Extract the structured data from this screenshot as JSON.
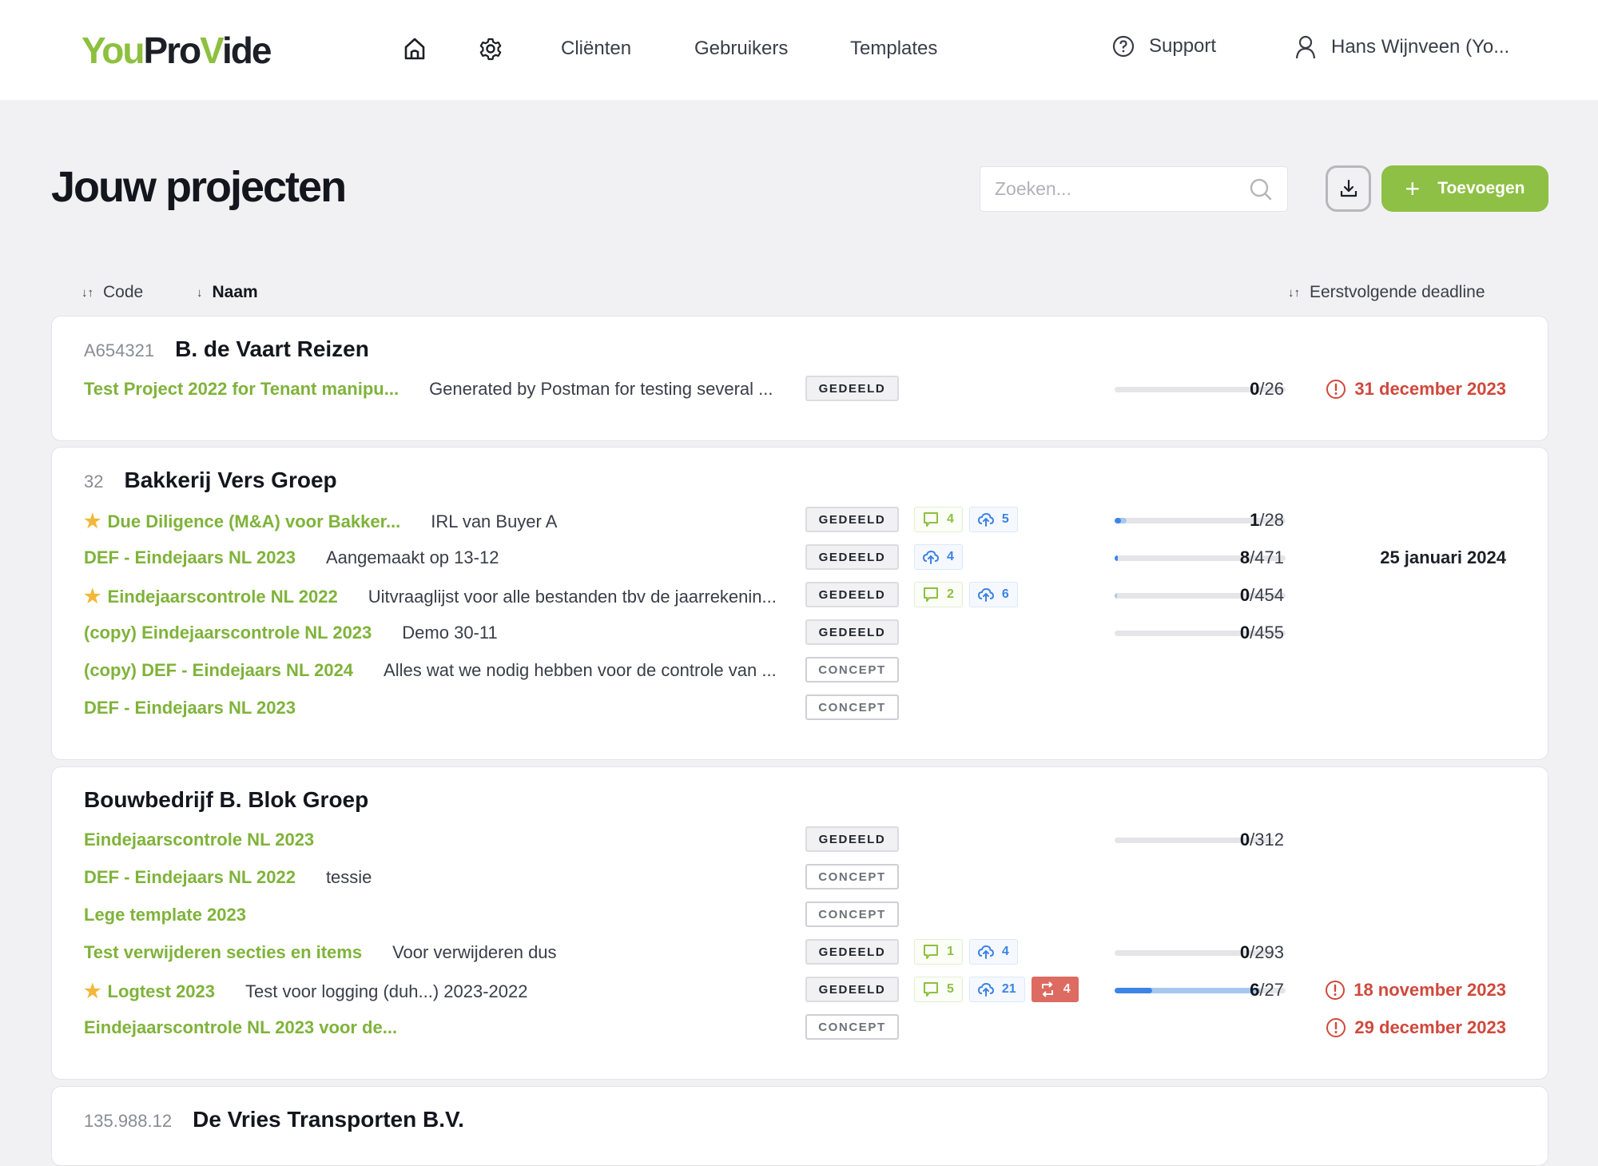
{
  "app": {
    "logo_part1": "You",
    "logo_part2": "Pro",
    "logo_part3": "V",
    "logo_part4": "ide"
  },
  "nav": {
    "home_icon": "home-icon",
    "settings_icon": "gear-icon",
    "links": [
      "Cliënten",
      "Gebruikers",
      "Templates"
    ],
    "support": "Support",
    "user": "Hans Wijnveen (Yo..."
  },
  "header": {
    "title": "Jouw projecten",
    "search_placeholder": "Zoeken...",
    "add_label": "Toevoegen",
    "add_icon": "+"
  },
  "sort": {
    "code": "Code",
    "name": "Naam",
    "deadline": "Eerstvolgende deadline"
  },
  "colors": {
    "brand_green": "#8dc044",
    "overdue_red": "#d0483c",
    "upload_blue": "#3b82e6"
  },
  "clients": [
    {
      "code": "A654321",
      "name": "B. de Vaart Reizen",
      "projects": [
        {
          "title": "Test Project 2022 for Tenant manipu...",
          "starred": false,
          "desc": "Generated by Postman for testing several ...",
          "status": "GEDEELD",
          "comments": null,
          "uploads": null,
          "issues": null,
          "done": "0",
          "total": "/26",
          "progress": 0,
          "progress_secondary": 0,
          "deadline": "31 december 2023",
          "overdue": true
        }
      ]
    },
    {
      "code": "32",
      "name": "Bakkerij Vers Groep",
      "projects": [
        {
          "title": "Due Diligence (M&A) voor Bakker...",
          "starred": true,
          "desc": "IRL van Buyer A",
          "status": "GEDEELD",
          "comments": "4",
          "uploads": "5",
          "issues": null,
          "done": "1",
          "total": "/28",
          "progress": 0.036,
          "progress_secondary": 0.07,
          "deadline": "",
          "overdue": false
        },
        {
          "title": "DEF - Eindejaars NL 2023",
          "starred": false,
          "desc": "Aangemaakt op 13-12",
          "status": "GEDEELD",
          "comments": null,
          "uploads": "4",
          "issues": null,
          "done": "8",
          "total": "/471",
          "progress": 0.017,
          "progress_secondary": 0.017,
          "deadline": "25 januari 2024",
          "overdue": false
        },
        {
          "title": "Eindejaarscontrole NL 2022",
          "starred": true,
          "desc": "Uitvraaglijst voor alle bestanden tbv de jaarrekenin...",
          "status": "GEDEELD",
          "comments": "2",
          "uploads": "6",
          "issues": null,
          "done": "0",
          "total": "/454",
          "progress": 0,
          "progress_secondary": 0.013,
          "deadline": "",
          "overdue": false
        },
        {
          "title": "(copy) Eindejaarscontrole NL 2023",
          "starred": false,
          "desc": "Demo 30-11",
          "status": "GEDEELD",
          "comments": null,
          "uploads": null,
          "issues": null,
          "done": "0",
          "total": "/455",
          "progress": 0,
          "progress_secondary": 0,
          "deadline": "",
          "overdue": false
        },
        {
          "title": "(copy) DEF - Eindejaars NL 2024",
          "starred": false,
          "desc": "Alles wat we nodig hebben voor de controle van ...",
          "status": "CONCEPT",
          "comments": null,
          "uploads": null,
          "issues": null,
          "done": null,
          "total": null,
          "progress": null,
          "progress_secondary": null,
          "deadline": "",
          "overdue": false
        },
        {
          "title": "DEF - Eindejaars NL 2023",
          "starred": false,
          "desc": "",
          "status": "CONCEPT",
          "comments": null,
          "uploads": null,
          "issues": null,
          "done": null,
          "total": null,
          "progress": null,
          "progress_secondary": null,
          "deadline": "",
          "overdue": false
        }
      ]
    },
    {
      "code": "",
      "name": "Bouwbedrijf B. Blok Groep",
      "projects": [
        {
          "title": "Eindejaarscontrole NL 2023",
          "starred": false,
          "desc": "",
          "status": "GEDEELD",
          "comments": null,
          "uploads": null,
          "issues": null,
          "done": "0",
          "total": "/312",
          "progress": 0,
          "progress_secondary": 0,
          "deadline": "",
          "overdue": false
        },
        {
          "title": "DEF - Eindejaars NL 2022",
          "starred": false,
          "desc": "tessie",
          "status": "CONCEPT",
          "comments": null,
          "uploads": null,
          "issues": null,
          "done": null,
          "total": null,
          "progress": null,
          "progress_secondary": null,
          "deadline": "",
          "overdue": false
        },
        {
          "title": "Lege template 2023",
          "starred": false,
          "desc": "",
          "status": "CONCEPT",
          "comments": null,
          "uploads": null,
          "issues": null,
          "done": null,
          "total": null,
          "progress": null,
          "progress_secondary": null,
          "deadline": "",
          "overdue": false
        },
        {
          "title": "Test verwijderen secties en items",
          "starred": false,
          "desc": "Voor verwijderen dus",
          "status": "GEDEELD",
          "comments": "1",
          "uploads": "4",
          "issues": null,
          "done": "0",
          "total": "/293",
          "progress": 0,
          "progress_secondary": 0,
          "deadline": "",
          "overdue": false
        },
        {
          "title": "Logtest 2023",
          "starred": true,
          "desc": "Test voor logging (duh...) 2023-2022",
          "status": "GEDEELD",
          "comments": "5",
          "uploads": "21",
          "issues": "4",
          "done": "6",
          "total": "/27",
          "progress": 0.22,
          "progress_secondary": 0.85,
          "deadline": "18 november 2023",
          "overdue": true
        },
        {
          "title": "Eindejaarscontrole NL 2023 voor de...",
          "starred": false,
          "desc": "",
          "status": "CONCEPT",
          "comments": null,
          "uploads": null,
          "issues": null,
          "done": null,
          "total": null,
          "progress": null,
          "progress_secondary": null,
          "deadline": "29 december 2023",
          "overdue": true
        }
      ]
    },
    {
      "code": "135.988.12",
      "name": "De Vries Transporten B.V.",
      "projects": []
    }
  ]
}
